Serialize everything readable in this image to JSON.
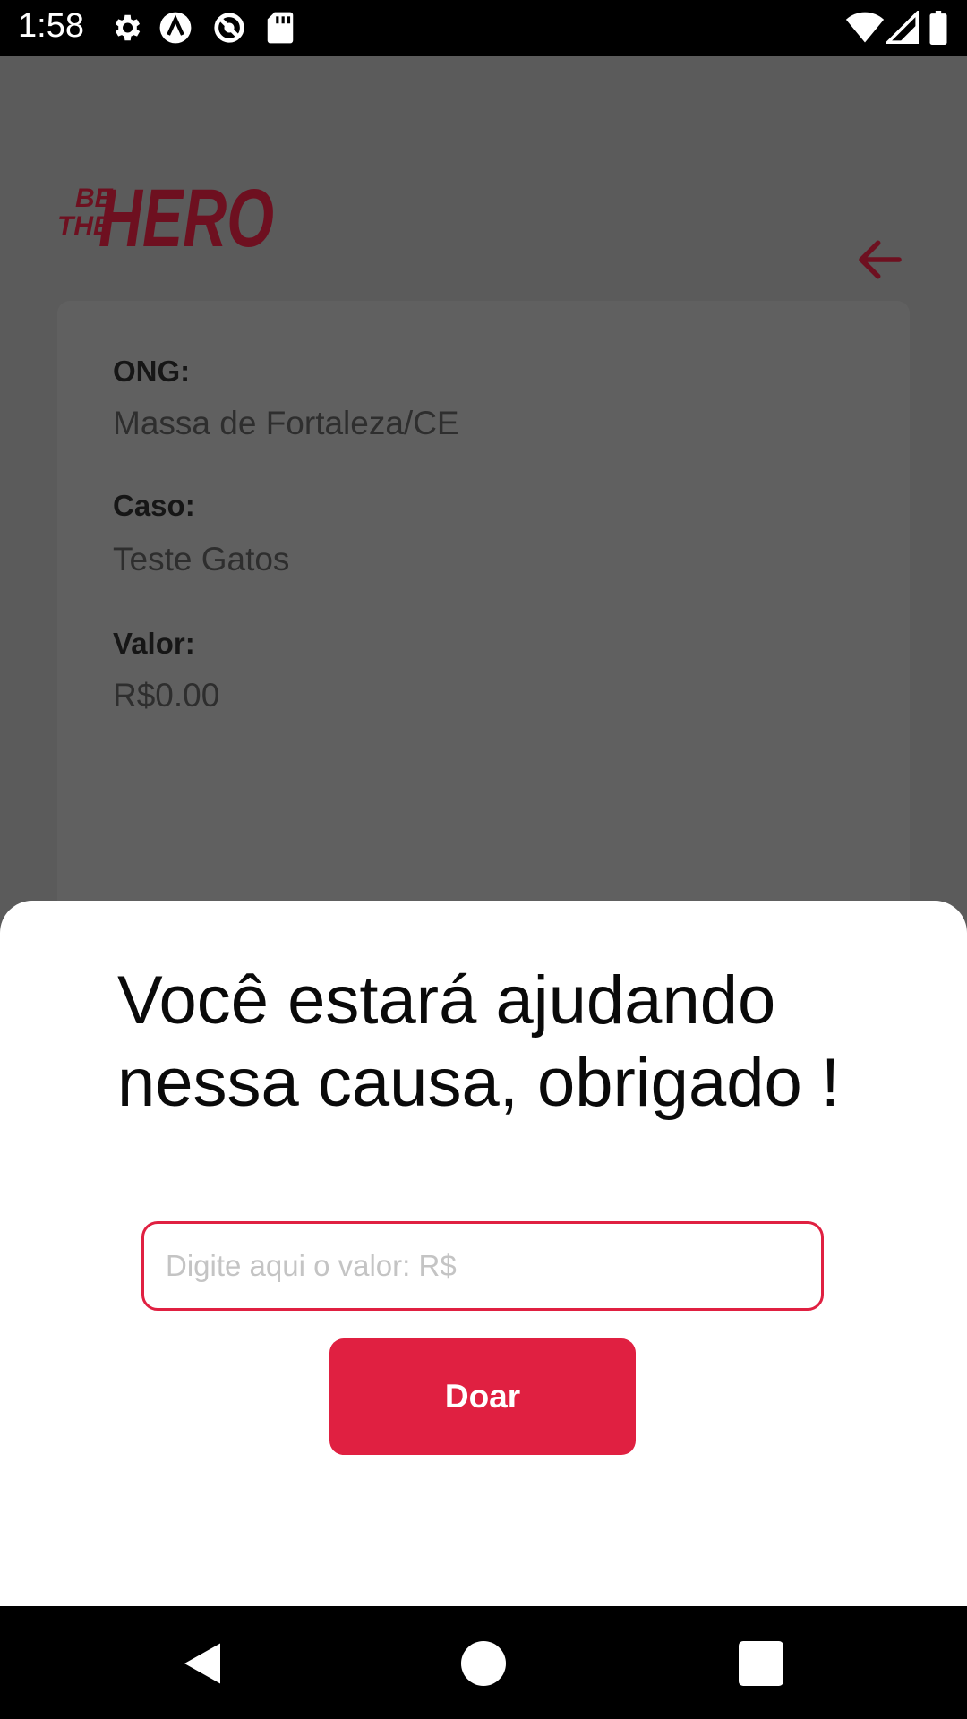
{
  "status_bar": {
    "time": "1:58",
    "icons": [
      "settings-icon",
      "a-icon",
      "blocked-icon",
      "sd-card-icon",
      "wifi-icon",
      "signal-icon",
      "battery-icon"
    ]
  },
  "header": {
    "logo_text_small_1": "BE",
    "logo_text_small_2": "THE",
    "logo_text_big": "HERO",
    "back_icon": "arrow-left-icon"
  },
  "incident": {
    "ong_label": "ONG:",
    "ong_value": "Massa de Fortaleza/CE",
    "case_label": "Caso:",
    "case_value": "Teste Gatos",
    "value_label": "Valor:",
    "value_value": "R$0.00"
  },
  "sheet": {
    "title": "Você estará ajudando nessa causa, obrigado !",
    "input_placeholder": "Digite aqui o valor: R$",
    "input_value": "",
    "donate_label": "Doar"
  },
  "nav": {
    "icons": [
      "back-triangle-icon",
      "home-circle-icon",
      "recents-square-icon"
    ]
  },
  "colors": {
    "accent": "#e02041",
    "overlay_bg": "#5b5b5b",
    "logo_dim": "#6e1020"
  }
}
